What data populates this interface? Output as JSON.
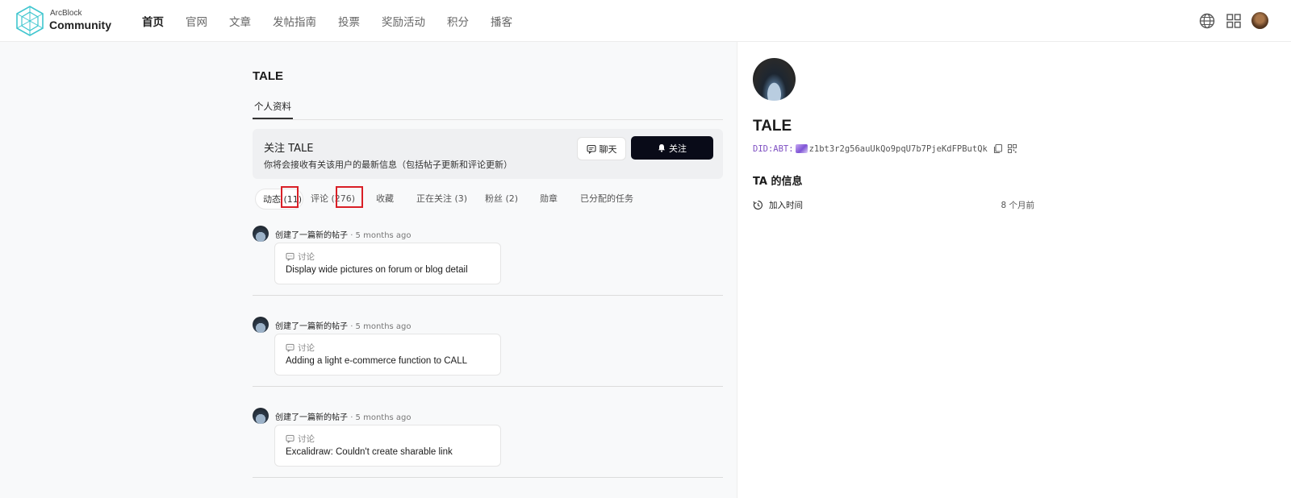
{
  "header": {
    "brand_top": "ArcBlock",
    "brand_main": "Community",
    "nav": [
      "首页",
      "官网",
      "文章",
      "发帖指南",
      "投票",
      "奖励活动",
      "积分",
      "播客"
    ],
    "icons": [
      "globe-icon",
      "apps-grid-icon",
      "user-avatar"
    ]
  },
  "profile": {
    "title": "TALE",
    "tab_label": "个人资料",
    "follow_card": {
      "title": "关注 TALE",
      "description": "你将会接收有关该用户的最新信息（包括帖子更新和评论更新）",
      "chat_label": "聊天",
      "follow_label": "关注"
    },
    "subtabs": [
      "动态 (11)",
      "评论 (276)",
      "收藏",
      "正在关注 (3)",
      "粉丝 (2)",
      "勋章",
      "已分配的任务"
    ]
  },
  "feed": [
    {
      "action": "创建了一篇新的帖子",
      "time": "· 5 months ago",
      "category": "讨论",
      "title": "Display wide pictures on forum or blog detail"
    },
    {
      "action": "创建了一篇新的帖子",
      "time": "· 5 months ago",
      "category": "讨论",
      "title": "Adding a light e-commerce function to CALL"
    },
    {
      "action": "创建了一篇新的帖子",
      "time": "· 5 months ago",
      "category": "讨论",
      "title": "Excalidraw: Couldn't create sharable link"
    }
  ],
  "side": {
    "name": "TALE",
    "did_prefix": "DID:ABT:",
    "did_value": "z1bt3r2g56auUkQo9pqU7b7PjeKdFPButQk",
    "info_title": "TA 的信息",
    "joined_label": "加入时间",
    "joined_value": "8 个月前"
  },
  "colors": {
    "accent_dark": "#090b18",
    "highlight_red": "#d91f26",
    "did_purple": "#7e4fc2"
  }
}
